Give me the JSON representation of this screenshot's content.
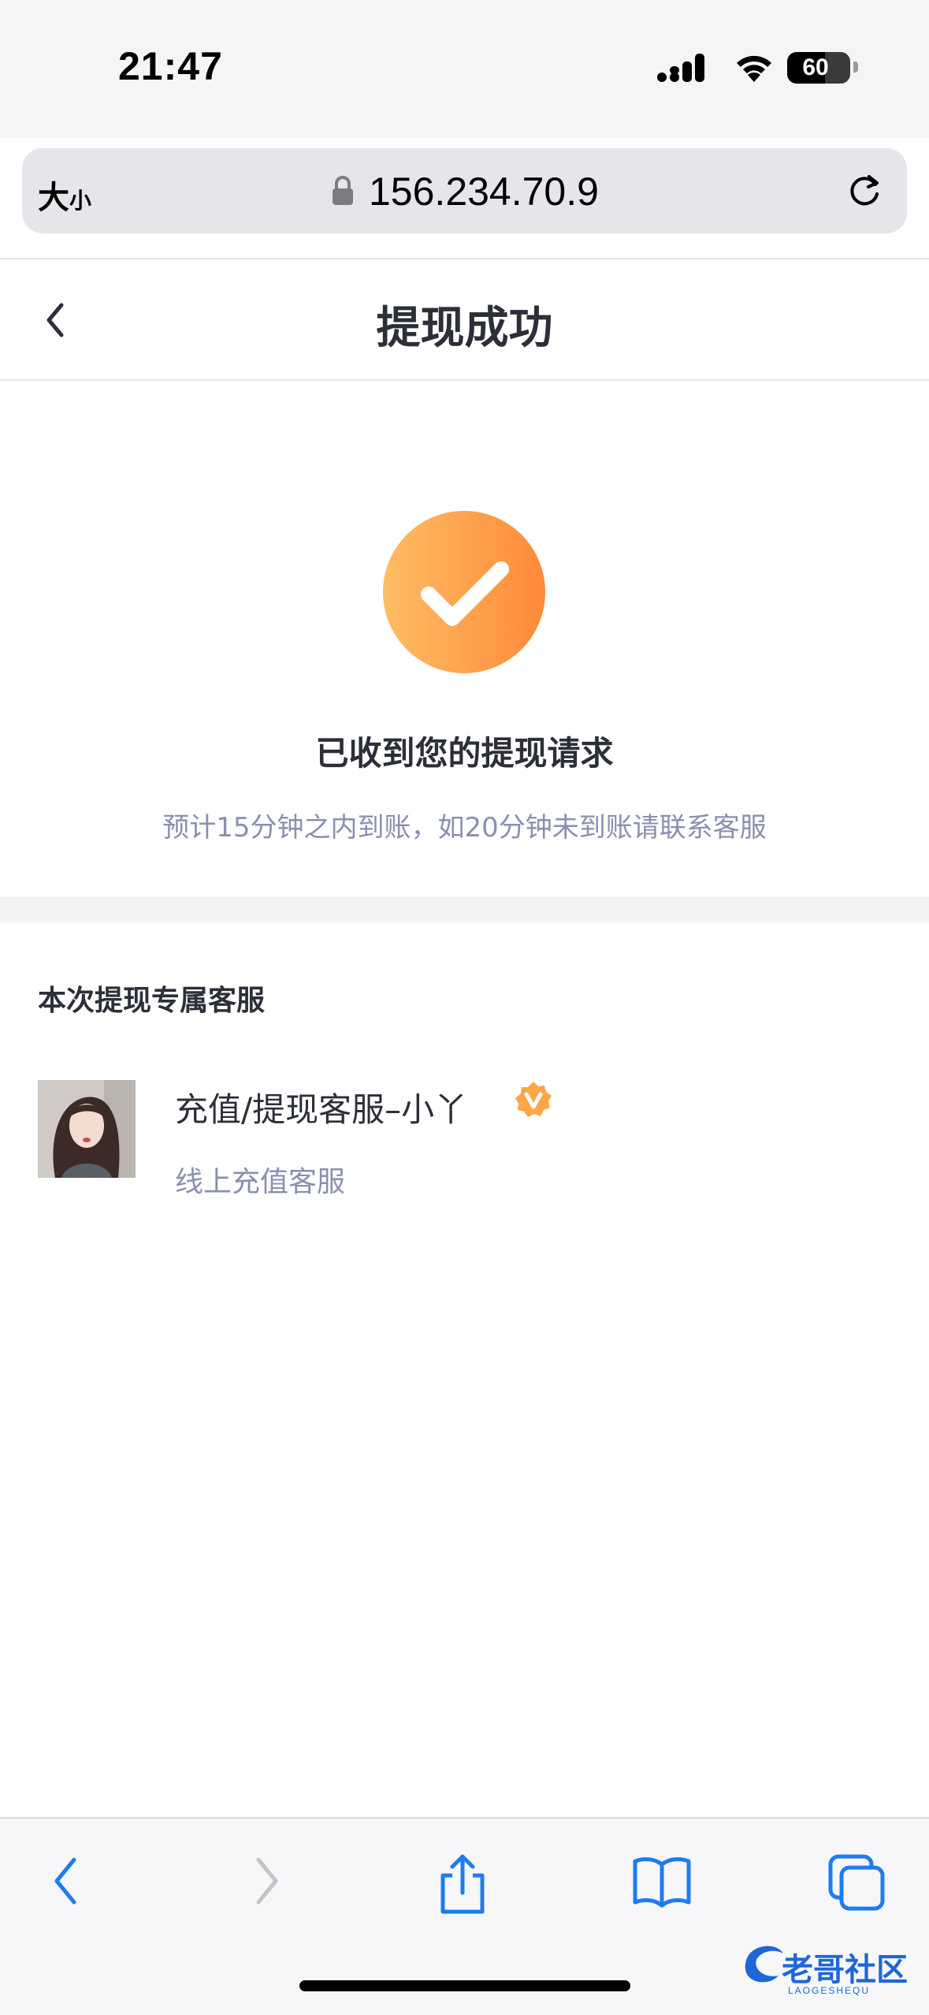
{
  "status_bar": {
    "time": "21:47",
    "battery_percent": 60,
    "battery_label": "60"
  },
  "browser": {
    "text_size_label_big": "大",
    "text_size_label_small": "小",
    "url": "156.234.70.9"
  },
  "header": {
    "title": "提现成功"
  },
  "success": {
    "title": "已收到您的提现请求",
    "subtitle": "预计15分钟之内到账，如20分钟未到账请联系客服"
  },
  "customer_service": {
    "heading": "本次提现专属客服",
    "agent": {
      "name": "充值/提现客服–小丫",
      "description": "线上充值客服",
      "verified": true
    }
  },
  "watermark": {
    "text": "老哥社区",
    "sub": "LAOGESHEQU"
  },
  "colors": {
    "accent_orange_start": "#ffbd63",
    "accent_orange_end": "#ff8a3a",
    "ios_blue": "#1e7cf2",
    "muted_text": "#8a8fb0"
  },
  "icons": {
    "back": "chevron-left-icon",
    "success": "checkmark-circle-icon",
    "verified": "verified-badge-icon",
    "lock": "lock-icon",
    "reload": "reload-icon",
    "toolbar": [
      "back-arrow-icon",
      "forward-arrow-icon",
      "share-icon",
      "bookmarks-icon",
      "tabs-icon"
    ]
  }
}
